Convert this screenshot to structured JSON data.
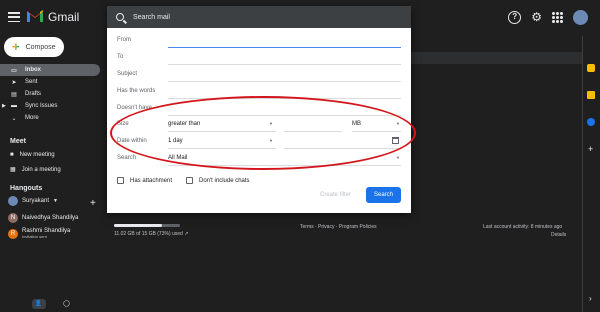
{
  "app": {
    "brand": "Gmail"
  },
  "topbar": {
    "help_icon": "?"
  },
  "sidebar": {
    "compose_label": "Compose",
    "items": [
      {
        "label": "Inbox",
        "icon": "inbox-icon",
        "active": true
      },
      {
        "label": "Sent",
        "icon": "send-icon"
      },
      {
        "label": "Drafts",
        "icon": "draft-icon"
      },
      {
        "label": "Sync Issues",
        "icon": "folder-icon"
      },
      {
        "label": "More",
        "icon": "chevron-down-icon"
      }
    ],
    "meet": {
      "title": "Meet",
      "new_meeting": "New meeting",
      "join_meeting": "Join a meeting"
    },
    "hangouts": {
      "title": "Hangouts",
      "me": "Suryakant",
      "contacts": [
        {
          "name": "Naivedhya Shandilya",
          "initial": "N",
          "color": "#8d6e63"
        },
        {
          "name": "Rashmi Shandilya",
          "sub": "Invitation sent",
          "initial": "R",
          "color": "#e8710a"
        }
      ]
    }
  },
  "search": {
    "placeholder": "Search mail",
    "fields": {
      "from": "From",
      "to": "To",
      "subject": "Subject",
      "has_words": "Has the words",
      "doesnt_have": "Doesn't have",
      "size_label": "Size",
      "size_op": "greater than",
      "size_unit": "MB",
      "date_label": "Date within",
      "date_value": "1 day",
      "search_label": "Search",
      "search_value": "All Mail"
    },
    "has_attachment": "Has attachment",
    "no_chats": "Don't include chats",
    "create_filter": "Create filter",
    "search_button": "Search"
  },
  "footer": {
    "storage": "11.02 GB of 15 GB (73%) used",
    "storage_fraction": 0.73,
    "terms": "Terms · Privacy · Program Policies",
    "activity": "Last account activity: 8 minutes ago",
    "details": "Details"
  },
  "colors": {
    "accent": "#1a73e8",
    "annotation": "#d3161b"
  }
}
